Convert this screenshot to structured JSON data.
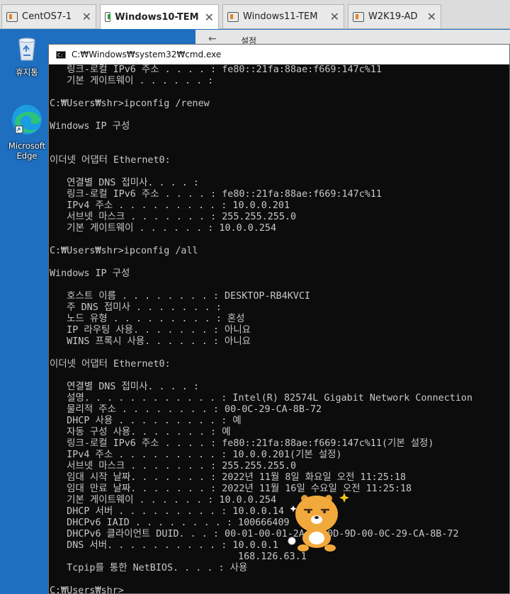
{
  "tabs": [
    {
      "label": "CentOS7-1",
      "active": false
    },
    {
      "label": "Windows10-TEM",
      "active": true
    },
    {
      "label": "Windows11-TEM",
      "active": false
    },
    {
      "label": "W2K19-AD",
      "active": false
    }
  ],
  "desktop": {
    "recycle_bin": "휴지통",
    "edge_line1": "Microsoft",
    "edge_line2": "Edge"
  },
  "settings_window": {
    "title": "설정"
  },
  "cmd": {
    "title": "C:₩Windows₩system32₩cmd.exe",
    "lines": [
      "   링크-로컬 IPv6 주소 . . . . : fe80::21fa:88ae:f669:147c%11",
      "   기본 게이트웨이 . . . . . . :",
      "",
      "C:₩Users₩shr>ipconfig /renew",
      "",
      "Windows IP 구성",
      "",
      "",
      "이더넷 어댑터 Ethernet0:",
      "",
      "   연결별 DNS 접미사. . . . :",
      "   링크-로컬 IPv6 주소 . . . . : fe80::21fa:88ae:f669:147c%11",
      "   IPv4 주소 . . . . . . . . . : 10.0.0.201",
      "   서브넷 마스크 . . . . . . . : 255.255.255.0",
      "   기본 게이트웨이 . . . . . . : 10.0.0.254",
      "",
      "C:₩Users₩shr>ipconfig /all",
      "",
      "Windows IP 구성",
      "",
      "   호스트 이름 . . . . . . . . : DESKTOP-RB4KVCI",
      "   주 DNS 접미사 . . . . . . . :",
      "   노드 유형 . . . . . . . . . : 혼성",
      "   IP 라우팅 사용. . . . . . . : 아니요",
      "   WINS 프록시 사용. . . . . . : 아니요",
      "",
      "이더넷 어댑터 Ethernet0:",
      "",
      "   연결별 DNS 접미사. . . . :",
      "   설명. . . . . . . . . . . . : Intel(R) 82574L Gigabit Network Connection",
      "   물리적 주소 . . . . . . . . : 00-0C-29-CA-8B-72",
      "   DHCP 사용 . . . . . . . . . : 예",
      "   자동 구성 사용. . . . . . . : 예",
      "   링크-로컬 IPv6 주소 . . . . : fe80::21fa:88ae:f669:147c%11(기본 설정)",
      "   IPv4 주소 . . . . . . . . . : 10.0.0.201(기본 설정)",
      "   서브넷 마스크 . . . . . . . : 255.255.255.0",
      "   임대 시작 날짜. . . . . . . : 2022년 11월 8일 화요일 오전 11:25:18",
      "   임대 만료 날짜. . . . . . . : 2022년 11월 16일 수요일 오전 11:25:18",
      "   기본 게이트웨이 . . . . . . : 10.0.0.254",
      "   DHCP 서버 . . . . . . . . . : 10.0.0.14",
      "   DHCPv6 IAID . . . . . . . . : 100666409",
      "   DHCPv6 클라이언트 DUID. . . : 00-01-00-01-2A-FD-0D-9D-00-0C-29-CA-8B-72",
      "   DNS 서버. . . . . . . . . . : 10.0.0.1",
      "                                 168.126.63.1",
      "   Tcpip를 통한 NetBIOS. . . . : 사용",
      "",
      "C:₩Users₩shr>"
    ]
  },
  "colors": {
    "desktop_bg": "#1e6fc0",
    "console_bg": "#0c0c0c",
    "console_fg": "#c8c8c8",
    "active_tab_icon": "#2b9e3a",
    "inactive_tab_icon": "#e8822a"
  }
}
